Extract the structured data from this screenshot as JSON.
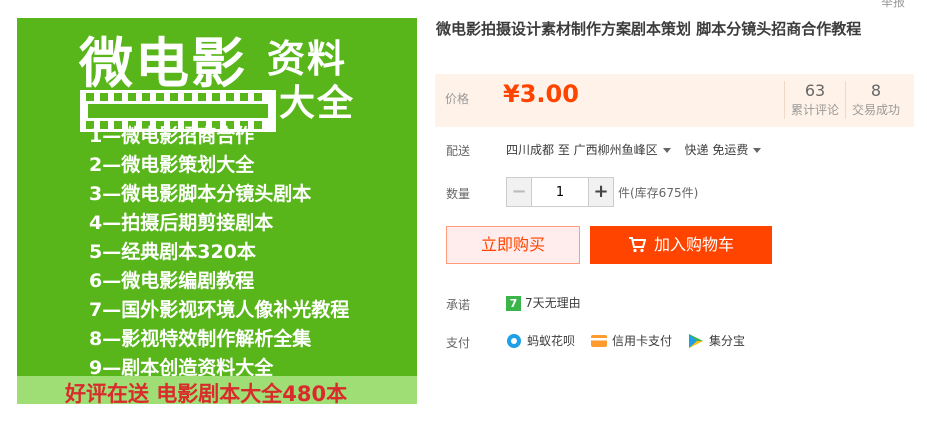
{
  "header": {
    "report_label": "举报"
  },
  "image": {
    "heading_1": "微电影",
    "heading_2": "资料",
    "heading_3": "大全",
    "list": [
      "1—微电影招商合作",
      "2—微电影策划大全",
      "3—微电影脚本分镜头剧本",
      "4—拍摄后期剪接剧本",
      "5—经典剧本320本",
      "6—微电影编剧教程",
      "7—国外影视环境人像补光教程",
      "8—影视特效制作解析全集",
      "9—剧本创造资料大全"
    ],
    "footer": "好评在送 电影剧本大全480本"
  },
  "product": {
    "title": "微电影拍摄设计素材制作方案剧本策划 脚本分镜头招商合作教程",
    "price_label": "价格",
    "price": "¥3.00",
    "reviews_count": "63",
    "reviews_label": "累计评论",
    "sales_count": "8",
    "sales_label": "交易成功"
  },
  "shipping": {
    "label": "配送",
    "from": "四川成都 至",
    "to": "广西柳州鱼峰区",
    "method": "快递 免运费"
  },
  "quantity": {
    "label": "数量",
    "value": "1",
    "minus": "−",
    "plus": "+",
    "stock": "件(库存675件)"
  },
  "actions": {
    "buy_now": "立即购买",
    "add_to_cart": "加入购物车"
  },
  "promise": {
    "label": "承诺",
    "icon_text": "7",
    "text": "7天无理由"
  },
  "payment": {
    "label": "支付",
    "methods": [
      "蚂蚁花呗",
      "信用卡支付",
      "集分宝"
    ]
  },
  "colors": {
    "accent": "#ff4400",
    "image_green": "#58b61a"
  }
}
